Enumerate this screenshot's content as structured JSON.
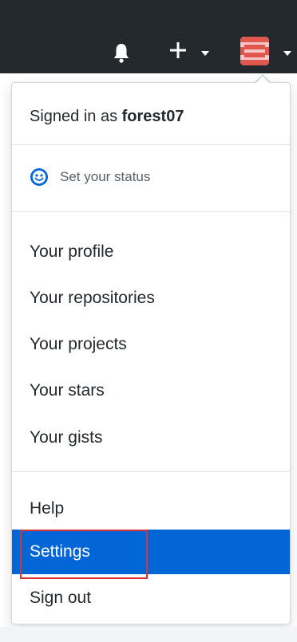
{
  "header": {
    "notifications_icon": "bell-icon",
    "create_icon": "plus-icon",
    "avatar_icon": "identicon-avatar"
  },
  "dropdown": {
    "signed_in_prefix": "Signed in as",
    "username": "forest07",
    "status": {
      "icon": "smiley-icon",
      "label": "Set your status"
    },
    "items": [
      {
        "label": "Your profile"
      },
      {
        "label": "Your repositories"
      },
      {
        "label": "Your projects"
      },
      {
        "label": "Your stars"
      },
      {
        "label": "Your gists"
      },
      {
        "label": "Help"
      },
      {
        "label": "Settings",
        "active": true
      },
      {
        "label": "Sign out"
      }
    ]
  },
  "colors": {
    "header_bg": "#24292e",
    "active_bg": "#0366d6",
    "highlight_border": "#e03131"
  }
}
